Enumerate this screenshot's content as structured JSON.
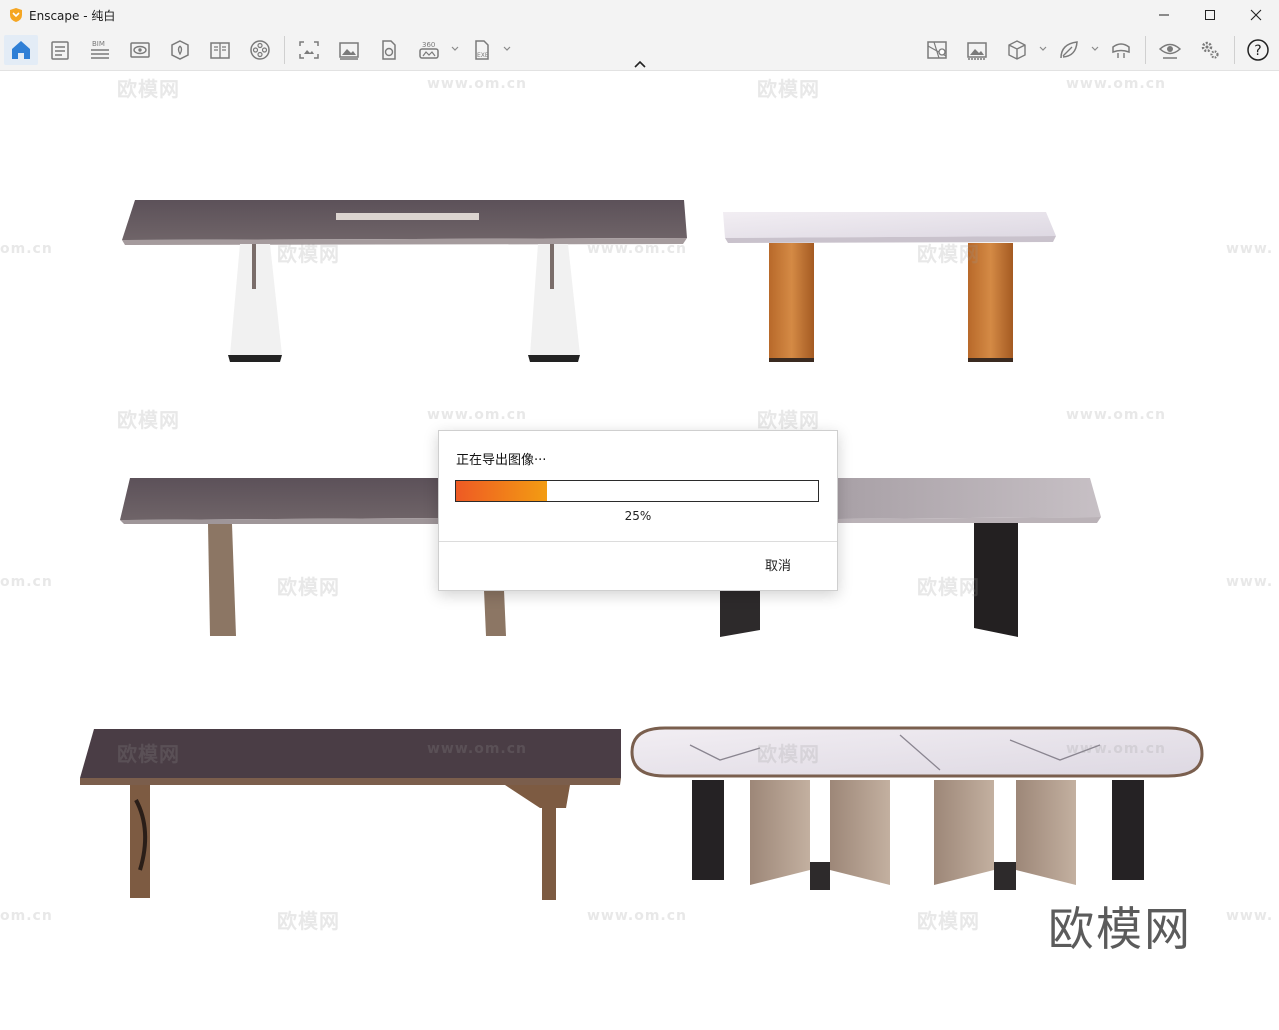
{
  "window": {
    "title": "Enscape - 纯白",
    "minimize_glyph": "—",
    "maximize_glyph": "☐",
    "close_glyph": "✕"
  },
  "toolbar": {
    "left_icons": [
      "home-icon",
      "bim-info-icon",
      "bim-list-icon",
      "view-icon",
      "asset-library-icon",
      "book-icon",
      "video-reel-icon",
      "screenshot-icon",
      "image-export-icon",
      "batch-render-icon",
      "panorama-360-icon",
      "exe-export-icon"
    ],
    "right_icons": [
      "map-icon",
      "gallery-icon",
      "cube-icon",
      "leaf-icon",
      "vr-headset-icon",
      "visibility-icon",
      "settings-icon",
      "help-icon"
    ],
    "bim_badge": "BIM",
    "pano_badge": "360",
    "exe_badge": "EXE",
    "help_glyph": "?"
  },
  "viewport": {
    "watermark_text": "欧模网",
    "watermark_url": "www.om.cn",
    "watermark_url_short": "om.cn",
    "watermark_url_partial": "www.",
    "big_watermark": "欧模网"
  },
  "dialog": {
    "title": "正在导出图像···",
    "progress": 0.25,
    "progress_label": "25%",
    "cancel_label": "取消"
  },
  "colors": {
    "progress_start": "#ee5a24",
    "progress_end": "#f39c12",
    "accent_blue": "#2f7fd6",
    "logo_orange": "#f5a623"
  }
}
